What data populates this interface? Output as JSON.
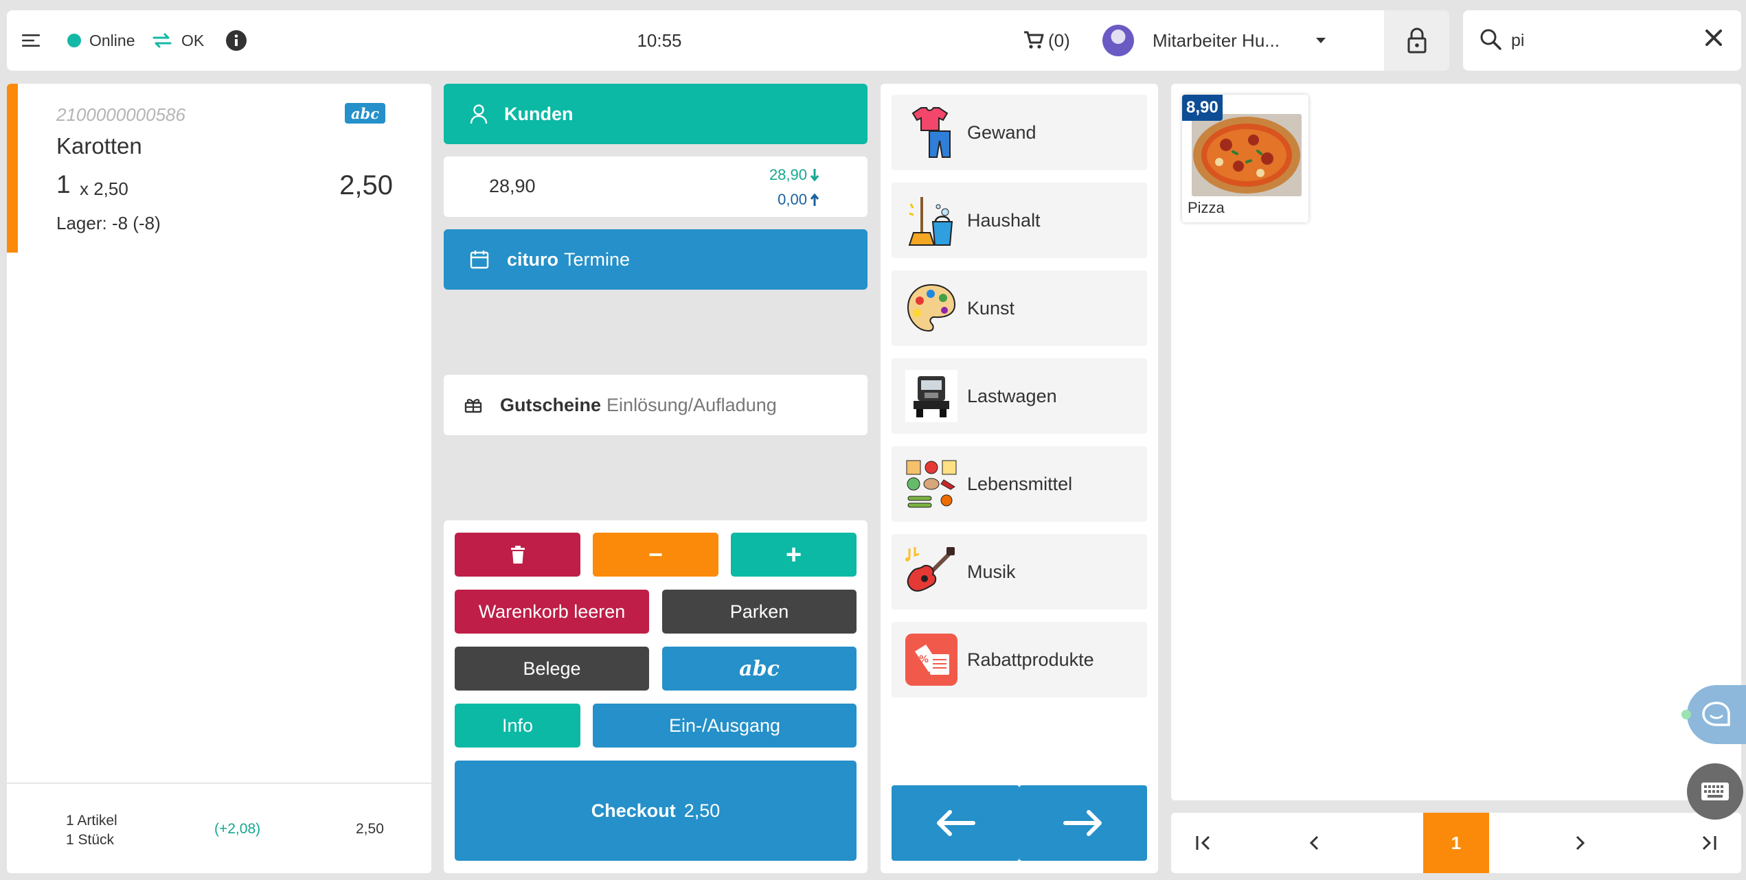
{
  "topbar": {
    "status_online": "Online",
    "status_sync": "OK",
    "clock": "10:55",
    "cart_count": "(0)",
    "user_name": "Mitarbeiter Hu..."
  },
  "search": {
    "value": "pi",
    "placeholder": ""
  },
  "cart": {
    "item": {
      "barcode": "2100000000586",
      "badge": "abc",
      "name": "Karotten",
      "qty": "1",
      "unit_price": "x 2,50",
      "total": "2,50",
      "stock": "Lager: -8 (-8)"
    },
    "footer": {
      "articles": "1 Artikel",
      "pieces": "1 Stück",
      "profit": "(+2,08)",
      "total": "2,50"
    }
  },
  "middle": {
    "customers_label": "Kunden",
    "balance_main": "28,90",
    "balance_in": "28,90",
    "balance_out": "0,00",
    "appointments_brand": "cituro",
    "appointments_label": "Termine",
    "vouchers_label": "Gutscheine",
    "vouchers_sub": "Einlösung/Aufladung"
  },
  "actions": {
    "minus": "−",
    "plus": "+",
    "clear_cart": "Warenkorb leeren",
    "park": "Parken",
    "receipts": "Belege",
    "abc": "abc",
    "info": "Info",
    "cash_io": "Ein-/Ausgang",
    "checkout_label": "Checkout",
    "checkout_amount": "2,50"
  },
  "categories": [
    {
      "label": "Gewand",
      "icon": "clothes-icon"
    },
    {
      "label": "Haushalt",
      "icon": "cleaning-icon"
    },
    {
      "label": "Kunst",
      "icon": "palette-icon"
    },
    {
      "label": "Lastwagen",
      "icon": "truck-icon"
    },
    {
      "label": "Lebensmittel",
      "icon": "groceries-icon"
    },
    {
      "label": "Musik",
      "icon": "guitar-icon"
    },
    {
      "label": "Rabattprodukte",
      "icon": "discount-icon"
    }
  ],
  "products": [
    {
      "name": "Pizza",
      "price": "8,90"
    }
  ],
  "pager": {
    "current": "1"
  },
  "colors": {
    "teal": "#0bb9a5",
    "blue": "#2590c9",
    "orange": "#fb8a0a",
    "red": "#be1e47",
    "dark": "#444444",
    "navy": "#0d4d95"
  }
}
